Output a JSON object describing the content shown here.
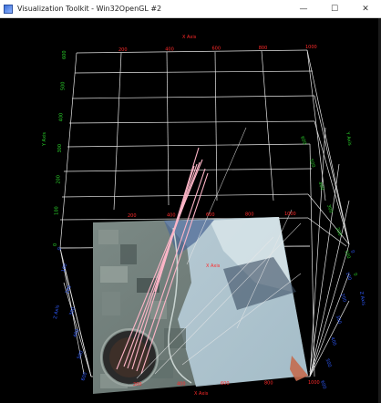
{
  "window": {
    "title": "Visualization Toolkit - Win32OpenGL #2",
    "minimize_glyph": "—",
    "maximize_glyph": "☐",
    "close_glyph": "✕"
  },
  "colors": {
    "x_axis": "#ff2a2a",
    "y_axis": "#2ad12a",
    "z_axis": "#2f5bff",
    "grid": "#ffffff",
    "background": "#000000",
    "lines": "#ffb6c8"
  },
  "axes": {
    "x_axis_title": "X Axis",
    "y_axis_title": "Y Axis",
    "z_axis_title": "Z Axis",
    "x_ticks_top": [
      "200",
      "400",
      "600",
      "800",
      "1000"
    ],
    "x_ticks_mid": [
      "200",
      "400",
      "600",
      "800",
      "1000"
    ],
    "x_ticks_bottom": [
      "200",
      "400",
      "600",
      "800",
      "1000"
    ],
    "y_ticks_left": [
      "600",
      "500",
      "400",
      "300",
      "200",
      "100",
      "0"
    ],
    "y_ticks_right": [
      "600",
      "500",
      "400",
      "300",
      "200",
      "100",
      "0"
    ],
    "z_ticks_left": [
      "0",
      "100",
      "200",
      "300",
      "400",
      "500",
      "600"
    ],
    "z_ticks_right": [
      "0",
      "100",
      "200",
      "300",
      "400",
      "500",
      "600"
    ]
  }
}
